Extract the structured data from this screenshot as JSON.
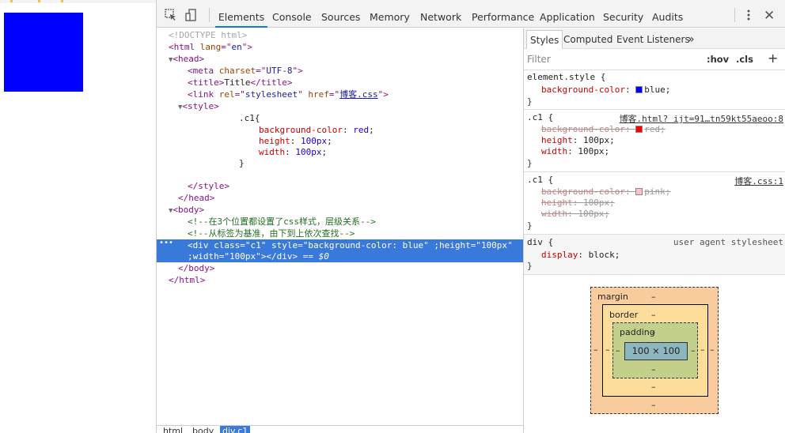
{
  "colors": {
    "page_box": "#0000ff",
    "accent": "#1a73e8",
    "selection": "#3879d9"
  },
  "toolbar": {
    "tabs": [
      {
        "label": "Elements"
      },
      {
        "label": "Console"
      },
      {
        "label": "Sources"
      },
      {
        "label": "Memory"
      },
      {
        "label": "Network"
      },
      {
        "label": "Performance"
      },
      {
        "label": "Application"
      },
      {
        "label": "Security"
      },
      {
        "label": "Audits"
      }
    ],
    "inspect_icon": "inspect-icon",
    "device_icon": "device-toolbar-icon",
    "more_icon": "more-vertical-icon",
    "close_icon": "close-icon"
  },
  "dom": {
    "doctype": "<!DOCTYPE html>",
    "html_open_tag": "html",
    "html_lang_attr": "lang",
    "html_lang_val": "en",
    "head_tag": "head",
    "meta_tag": "meta",
    "meta_attr": "charset",
    "meta_val": "UTF-8",
    "title_tag": "title",
    "title_text": "Title",
    "link_tag": "link",
    "link_rel_attr": "rel",
    "link_rel_val": "stylesheet",
    "link_href_attr": "href",
    "link_href_val": "博客.css",
    "style_tag": "style",
    "css_selector": ".c1{",
    "css_props": [
      {
        "name": "background-color",
        "value": "red"
      },
      {
        "name": "height",
        "value": "100px"
      },
      {
        "name": "width",
        "value": "100px"
      }
    ],
    "css_close": "}",
    "body_tag": "body",
    "comment1": "<!--在3个位置都设置了css样式，层级关系-->",
    "comment2": "<!--从标签为基准，由下到上依次查找-->",
    "div_tag": "div",
    "div_class_attr": "class",
    "div_class_val": "c1",
    "div_style_attr": "style",
    "div_style_val": "background-color: blue",
    "div_extra1_attr": ";height",
    "div_extra1_val": "100px",
    "div_extra2_attr": ";width",
    "div_extra2_val": "100px",
    "div_dollar": "== $0"
  },
  "breadcrumb": [
    {
      "label": "html"
    },
    {
      "label": "body"
    },
    {
      "label": "div.c1"
    }
  ],
  "styles_panel": {
    "tabs": [
      {
        "label": "Styles"
      },
      {
        "label": "Computed"
      },
      {
        "label": "Event Listeners"
      }
    ],
    "more": "»",
    "filter_placeholder": "Filter",
    "hov": ":hov",
    "cls": ".cls",
    "plus": "+",
    "rules": [
      {
        "selector": "element.style {",
        "source": "",
        "props": [
          {
            "name": "background-color",
            "value": "blue;",
            "swatch": "#0000ff",
            "struck": false
          }
        ]
      },
      {
        "selector": ".c1 {",
        "source": "博客.html? ijt=91…tn59kt55aeoo:8",
        "props": [
          {
            "name": "background-color",
            "value": "red;",
            "swatch": "#ff0000",
            "struck": true
          },
          {
            "name": "height",
            "value": "100px;",
            "struck": false
          },
          {
            "name": "width",
            "value": "100px;",
            "struck": false
          }
        ]
      },
      {
        "selector": ".c1 {",
        "source": "博客.css:1",
        "props": [
          {
            "name": "background-color",
            "value": "pink;",
            "swatch": "#ffc0cb",
            "struck": true
          },
          {
            "name": "height",
            "value": "100px;",
            "struck": true
          },
          {
            "name": "width",
            "value": "100px;",
            "struck": true
          }
        ]
      },
      {
        "selector": "div {",
        "source": "user agent stylesheet",
        "props": [
          {
            "name": "display",
            "value": "block;",
            "struck": false
          }
        ]
      }
    ],
    "close_brace": "}",
    "box_model": {
      "margin_label": "margin",
      "border_label": "border",
      "padding_label": "padding",
      "content": "100 × 100",
      "dash": "–"
    }
  }
}
